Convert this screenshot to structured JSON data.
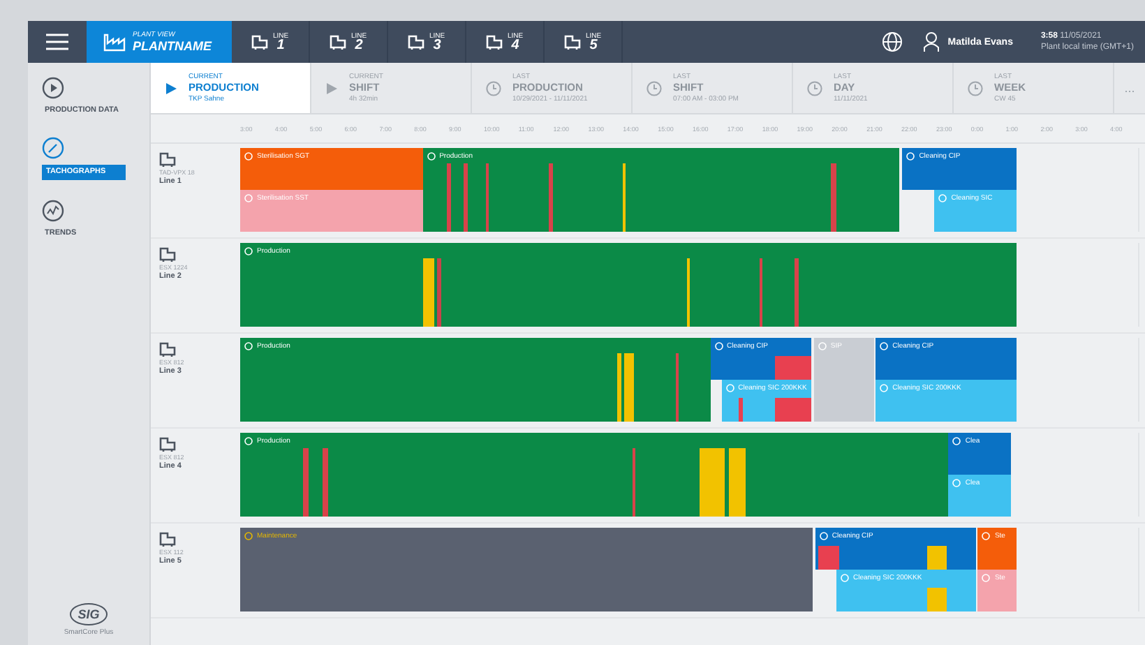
{
  "top_bar": {
    "app_caption": "PLANT VIEW",
    "plant": "PLANTNAME",
    "lines": [
      {
        "caption": "LINE",
        "number": "1"
      },
      {
        "caption": "LINE",
        "number": "2"
      },
      {
        "caption": "LINE",
        "number": "3"
      },
      {
        "caption": "LINE",
        "number": "4"
      },
      {
        "caption": "LINE",
        "number": "5"
      }
    ],
    "user": "Matilda Evans",
    "time": "3:58",
    "date": "11/05/2021",
    "timezone": "Plant local time (GMT+1)"
  },
  "sidebar": {
    "items": [
      {
        "label": "PRODUCTION DATA",
        "kind": "play",
        "selected": false
      },
      {
        "label": "TACHOGRAPHS",
        "kind": "gauge",
        "selected": true
      },
      {
        "label": "TRENDS",
        "kind": "trend",
        "selected": false
      }
    ],
    "footer": "SmartCore Plus",
    "logo": "SIG"
  },
  "tabs": [
    {
      "caption": "CURRENT",
      "title": "PRODUCTION",
      "detail": "TKP Sahne",
      "kind": "play",
      "selected": true
    },
    {
      "caption": "CURRENT",
      "title": "SHIFT",
      "detail": "4h 32min",
      "kind": "play",
      "selected": false
    },
    {
      "caption": "LAST",
      "title": "PRODUCTION",
      "detail": "10/29/2021 - 11/11/2021",
      "kind": "clock",
      "selected": false
    },
    {
      "caption": "LAST",
      "title": "SHIFT",
      "detail": "07:00 AM - 03:00 PM",
      "kind": "clock",
      "selected": false
    },
    {
      "caption": "LAST",
      "title": "DAY",
      "detail": "11/11/2021",
      "kind": "clock",
      "selected": false
    },
    {
      "caption": "LAST",
      "title": "WEEK",
      "detail": "CW 45",
      "kind": "clock",
      "selected": false
    }
  ],
  "more": "...",
  "timeline": {
    "ticks": [
      "3:00",
      "4:00",
      "5:00",
      "6:00",
      "7:00",
      "8:00",
      "9:00",
      "10:00",
      "11:00",
      "12:00",
      "13:00",
      "14:00",
      "15:00",
      "16:00",
      "17:00",
      "18:00",
      "19:00",
      "20:00",
      "21:00",
      "22:00",
      "23:00",
      "0:00",
      "1:00",
      "2:00",
      "3:00",
      "4:00"
    ]
  },
  "lines": [
    {
      "code": "TAD-VPX 18",
      "name": "Line 1",
      "blocks": [
        {
          "label": "Sterilisation SGT",
          "kind": "sterilisation"
        },
        {
          "label": "Sterilisation SST",
          "kind": "sterilisation-check"
        },
        {
          "label": "Production",
          "kind": "production"
        },
        {
          "label": "Cleaning CIP",
          "kind": "cleaning"
        },
        {
          "label": "Cleaning SIC",
          "kind": "cleaning-sic"
        }
      ]
    },
    {
      "code": "ESX 1224",
      "name": "Line 2",
      "blocks": [
        {
          "label": "Production",
          "kind": "production"
        }
      ]
    },
    {
      "code": "ESX 812",
      "name": "Line 3",
      "blocks": [
        {
          "label": "Production",
          "kind": "production"
        },
        {
          "label": "Cleaning CIP",
          "kind": "cleaning"
        },
        {
          "label": "Cleaning SIC 200KKK",
          "kind": "cleaning-sic"
        },
        {
          "label": "SIP",
          "kind": "idle"
        },
        {
          "label": "Cleaning CIP",
          "kind": "cleaning"
        },
        {
          "label": "Cleaning SIC 200KKK",
          "kind": "cleaning-sic"
        }
      ]
    },
    {
      "code": "ESX 812",
      "name": "Line 4",
      "blocks": [
        {
          "label": "Production",
          "kind": "production"
        },
        {
          "label": "Clea",
          "kind": "cleaning"
        },
        {
          "label": "Clea",
          "kind": "cleaning-sic"
        }
      ]
    },
    {
      "code": "ESX 112",
      "name": "Line 5",
      "blocks": [
        {
          "label": "Maintenance",
          "kind": "maintenance"
        },
        {
          "label": "Cleaning CIP",
          "kind": "cleaning"
        },
        {
          "label": "Cleaning SIC 200KKK",
          "kind": "cleaning-sic"
        },
        {
          "label": "Ste",
          "kind": "sterilisation"
        },
        {
          "label": "Ste",
          "kind": "sterilisation-check"
        }
      ]
    }
  ]
}
